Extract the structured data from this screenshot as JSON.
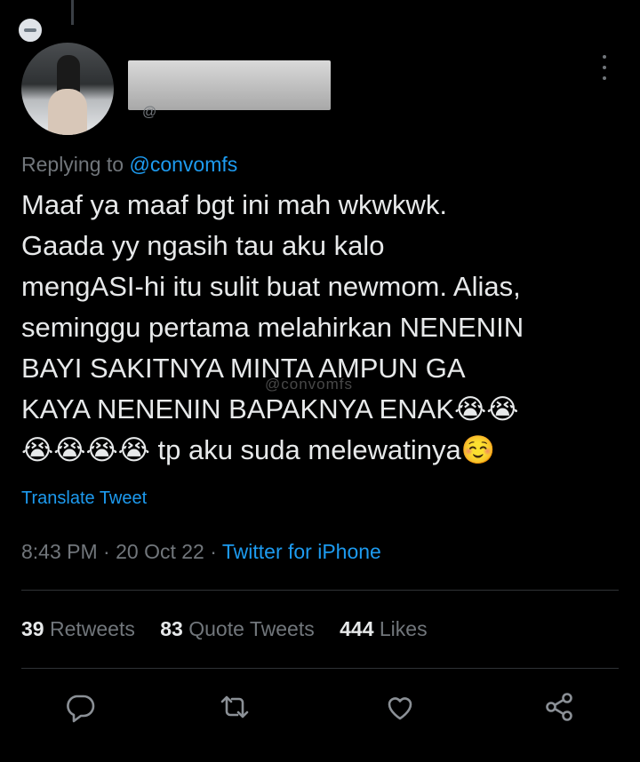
{
  "reply_context": {
    "prefix": "Replying to ",
    "handle": "@convomfs"
  },
  "tweet": {
    "lines": [
      "Maaf ya maaf bgt ini mah wkwkwk.",
      "Gaada yy ngasih tau aku kalo",
      "mengASI-hi itu sulit buat newmom. Alias,",
      "seminggu pertama melahirkan NENENIN",
      "BAYI SAKITNYA MINTA AMPUN GA",
      "KAYA NENENIN BAPAKNYA ENAK😭😭",
      "😭😭😭😭 tp aku suda melewatinya☺️"
    ],
    "watermark": "@convomfs"
  },
  "translate_label": "Translate Tweet",
  "meta": {
    "time": "8:43 PM",
    "sep1": " · ",
    "date": "20 Oct 22",
    "sep2": " · ",
    "source": "Twitter for iPhone"
  },
  "stats": {
    "retweets": {
      "count": "39",
      "label": "Retweets"
    },
    "quotes": {
      "count": "83",
      "label": "Quote Tweets"
    },
    "likes": {
      "count": "444",
      "label": "Likes"
    }
  },
  "actions": [
    "reply-icon",
    "retweet-icon",
    "like-icon",
    "share-icon"
  ],
  "colors": {
    "background": "#000000",
    "text": "#e7e9ea",
    "muted": "#71767b",
    "accent": "#1d9bf0",
    "divider": "#2f3336"
  }
}
